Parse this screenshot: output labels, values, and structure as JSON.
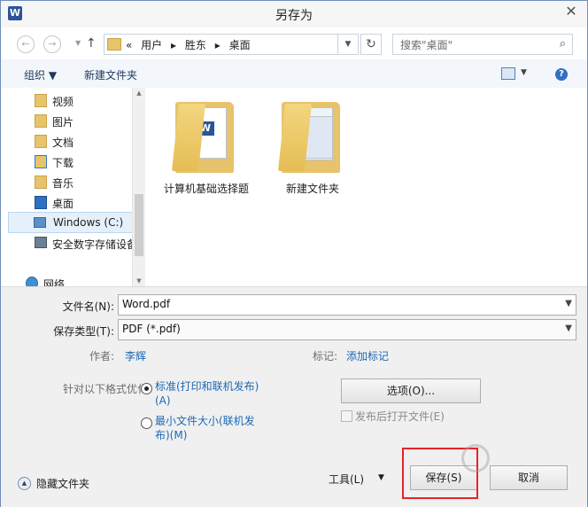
{
  "window": {
    "title": "另存为",
    "app_icon": "W",
    "close": "✕"
  },
  "nav": {
    "back": "←",
    "forward": "→",
    "dropdown": "▼",
    "up": "↑",
    "breadcrumb": [
      "«",
      "用户",
      "▸",
      "胜东",
      "▸",
      "桌面"
    ],
    "address_dropdown": "▼",
    "refresh": "↻",
    "search_placeholder": "搜索\"桌面\"",
    "search_icon": "⌕"
  },
  "toolbar": {
    "organize": "组织 ▼",
    "new_folder": "新建文件夹",
    "view_dropdown": "▼",
    "help": "?"
  },
  "sidebar": {
    "items": [
      {
        "label": "视频",
        "icon": "video-folder-icon"
      },
      {
        "label": "图片",
        "icon": "pictures-folder-icon"
      },
      {
        "label": "文档",
        "icon": "documents-folder-icon"
      },
      {
        "label": "下载",
        "icon": "downloads-folder-icon"
      },
      {
        "label": "音乐",
        "icon": "music-folder-icon"
      },
      {
        "label": "桌面",
        "icon": "desktop-folder-icon"
      },
      {
        "label": "Windows (C:)",
        "icon": "drive-icon"
      },
      {
        "label": "安全数字存储设备",
        "icon": "sd-card-icon"
      },
      {
        "label": "网络",
        "icon": "network-icon"
      }
    ]
  },
  "files": [
    {
      "name": "计算机基础选择题",
      "icon": "word-folder-icon"
    },
    {
      "name": "新建文件夹",
      "icon": "folder-icon"
    }
  ],
  "form": {
    "filename_label": "文件名(N):",
    "filename_value": "Word.pdf",
    "type_label": "保存类型(T):",
    "type_value": "PDF (*.pdf)",
    "author_label": "作者:",
    "author_value": "李辉",
    "tags_label": "标记:",
    "tags_value": "添加标记",
    "optimize_label": "针对以下格式优化:",
    "option_standard": [
      "标准(打印和联机发布)",
      "(A)"
    ],
    "option_minimum": [
      "最小文件大小(联机发",
      "布)(M)"
    ],
    "options_button": "选项(O)...",
    "open_after": "发布后打开文件(E)",
    "hide_folders": "隐藏文件夹",
    "tools": "工具(L)",
    "tools_dropdown": "▼",
    "save": "保存(S)",
    "cancel": "取消"
  },
  "colors": {
    "link": "#1c68b4",
    "highlight": "#e8222a",
    "folder": "#e7c36b"
  }
}
